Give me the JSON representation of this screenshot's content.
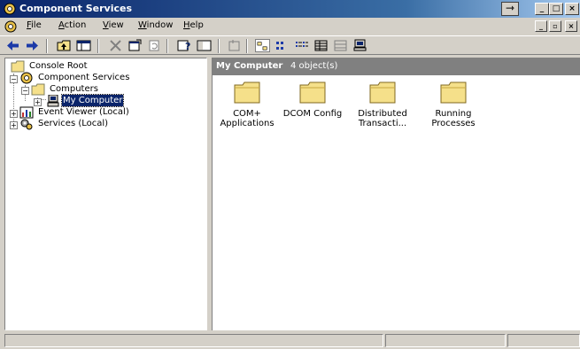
{
  "window": {
    "title": "Component Services"
  },
  "menu": [
    {
      "label_accel": "F",
      "label_rest": "ile"
    },
    {
      "label_accel": "A",
      "label_rest": "ction"
    },
    {
      "label_accel": "V",
      "label_rest": "iew"
    },
    {
      "label_accel": "W",
      "label_rest": "indow"
    },
    {
      "label_accel": "H",
      "label_rest": "elp"
    }
  ],
  "tree": {
    "root": "Console Root",
    "component_services": "Component Services",
    "computers": "Computers",
    "my_computer": "My Computer",
    "event_viewer": "Event Viewer (Local)",
    "services": "Services (Local)"
  },
  "right_pane": {
    "header_title": "My Computer",
    "header_count": "4 object(s)",
    "items": [
      {
        "line1": "COM+",
        "line2": "Applications"
      },
      {
        "line1": "DCOM Config",
        "line2": ""
      },
      {
        "line1": "Distributed",
        "line2": "Transacti..."
      },
      {
        "line1": "Running",
        "line2": "Processes"
      }
    ]
  },
  "colors": {
    "title_bar": "#0a246a",
    "selection": "#0a246a",
    "folder": "#f5e08a",
    "pane_header": "#808080",
    "chrome": "#d4d0c8"
  },
  "icons": {
    "back": "back-arrow-icon",
    "forward": "forward-arrow-icon",
    "folder": "folder-icon",
    "computer": "computer-icon"
  }
}
